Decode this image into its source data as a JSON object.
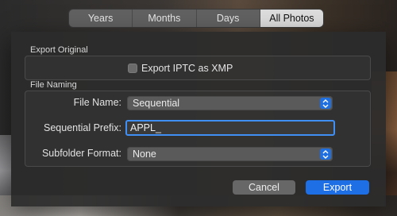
{
  "segmented": {
    "items": [
      {
        "label": "Years",
        "selected": false
      },
      {
        "label": "Months",
        "selected": false
      },
      {
        "label": "Days",
        "selected": false
      },
      {
        "label": "All Photos",
        "selected": true
      }
    ]
  },
  "dialog": {
    "export_original": {
      "section_label": "Export Original",
      "iptc_checkbox": {
        "label": "Export IPTC as XMP",
        "checked": false
      }
    },
    "file_naming": {
      "section_label": "File Naming",
      "file_name": {
        "label": "File Name:",
        "value": "Sequential"
      },
      "sequential_prefix": {
        "label": "Sequential Prefix:",
        "value": "APPL_"
      },
      "subfolder_format": {
        "label": "Subfolder Format:",
        "value": "None"
      }
    },
    "buttons": {
      "cancel": "Cancel",
      "export": "Export"
    }
  },
  "colors": {
    "accent": "#1e6fe6",
    "focus_ring": "#3f8ff4"
  }
}
